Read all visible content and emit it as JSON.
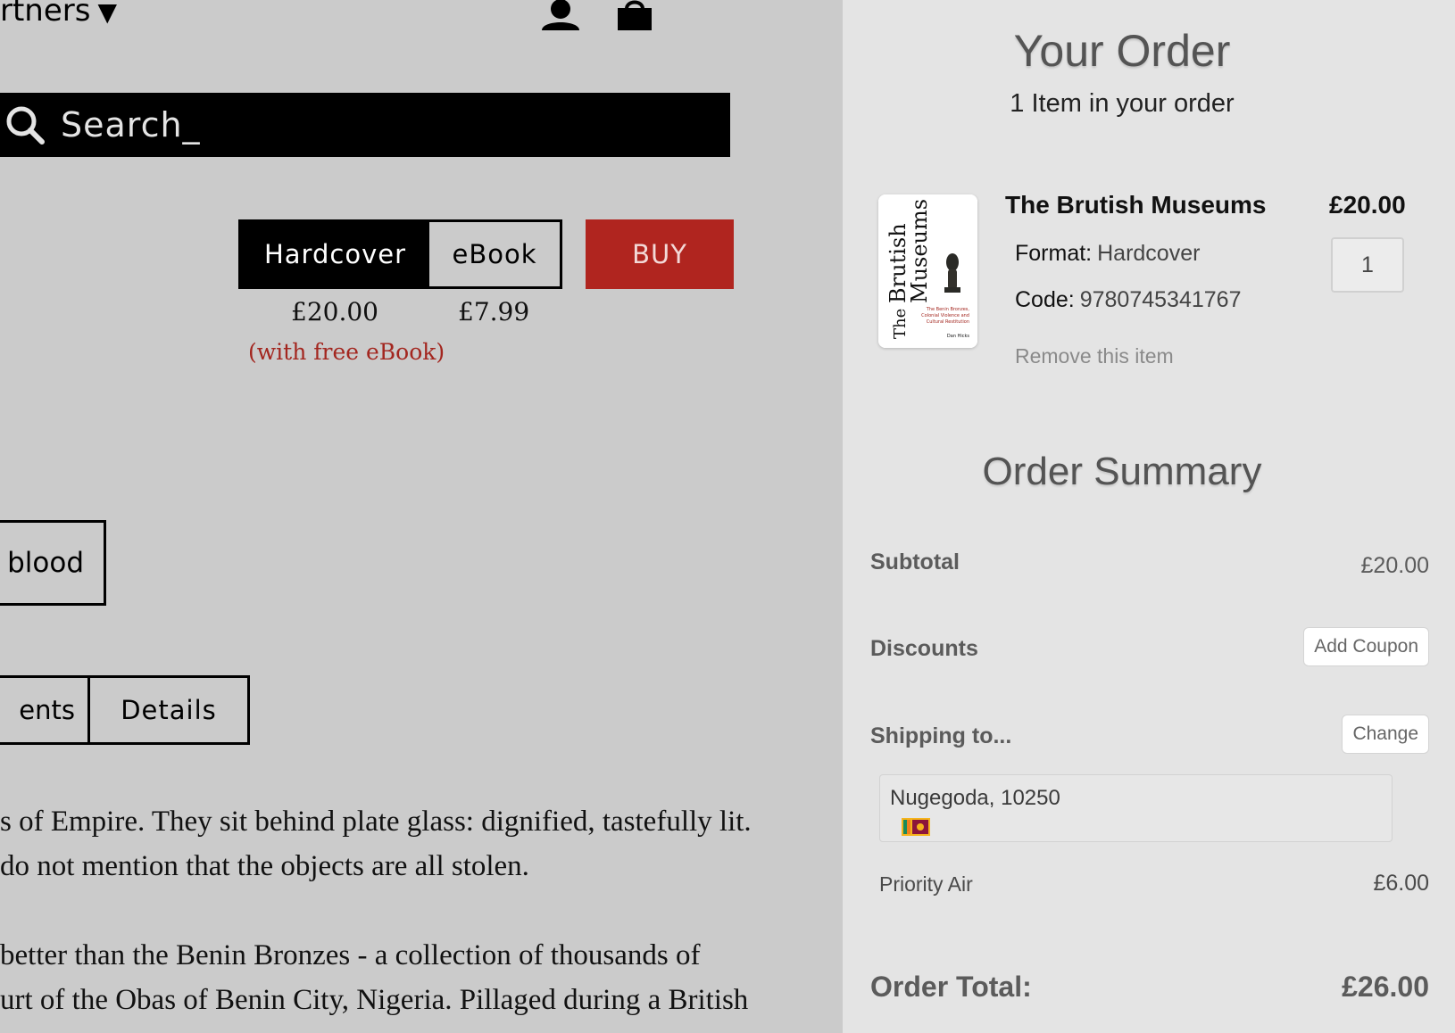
{
  "header": {
    "nav_partial": "rtners",
    "chevron": "▼"
  },
  "search": {
    "placeholder": "Search_"
  },
  "formats": {
    "hardcover_label": "Hardcover",
    "ebook_label": "eBook",
    "hardcover_price": "£20.00",
    "ebook_price": "£7.99",
    "hardcover_note": "(with free eBook)"
  },
  "buy_label": "BUY",
  "tags": {
    "blood": "blood"
  },
  "tabs": {
    "contents_partial": "ents",
    "details": "Details"
  },
  "description": {
    "lines": [
      "s of Empire. They sit behind plate glass: dignified, tastefully lit.",
      " do not mention that the objects are all stolen.",
      "better than the Benin Bronzes - a collection of thousands of",
      "urt of the Obas of Benin City, Nigeria. Pillaged during a British"
    ]
  },
  "order": {
    "title": "Your Order",
    "subtitle": "1 Item in your order",
    "item": {
      "title": "The Brutish Museums",
      "price": "£20.00",
      "quantity": "1",
      "format_label": "Format:",
      "format_value": "Hardcover",
      "code_label": "Code:",
      "code_value": "9780745341767",
      "remove_label": "Remove this item",
      "cover": {
        "title_the": "The",
        "title_brutish": "Brutish",
        "title_museums": "Museums",
        "subtitle_1": "The Benin Bronzes,",
        "subtitle_2": "Colonial Violence and",
        "subtitle_3": "Cultural Restitution",
        "author": "Dan Hicks"
      }
    }
  },
  "summary": {
    "title": "Order Summary",
    "subtotal_label": "Subtotal",
    "subtotal_value": "£20.00",
    "discounts_label": "Discounts",
    "add_coupon_label": "Add Coupon",
    "shipping_label": "Shipping to...",
    "change_label": "Change",
    "address": "Nugegoda, 10250",
    "shipping_method": "Priority Air",
    "shipping_price": "£6.00",
    "total_label": "Order Total:",
    "total_value": "£26.00"
  },
  "colors": {
    "page_bg": "#cbcbcb",
    "drawer_bg": "#e4e4e4",
    "buy_red": "#b0251f",
    "note_red": "#a3261f",
    "search_bg": "#000000"
  },
  "icons": [
    "account-icon",
    "basket-icon",
    "search-icon",
    "sri-lanka-flag-icon"
  ]
}
